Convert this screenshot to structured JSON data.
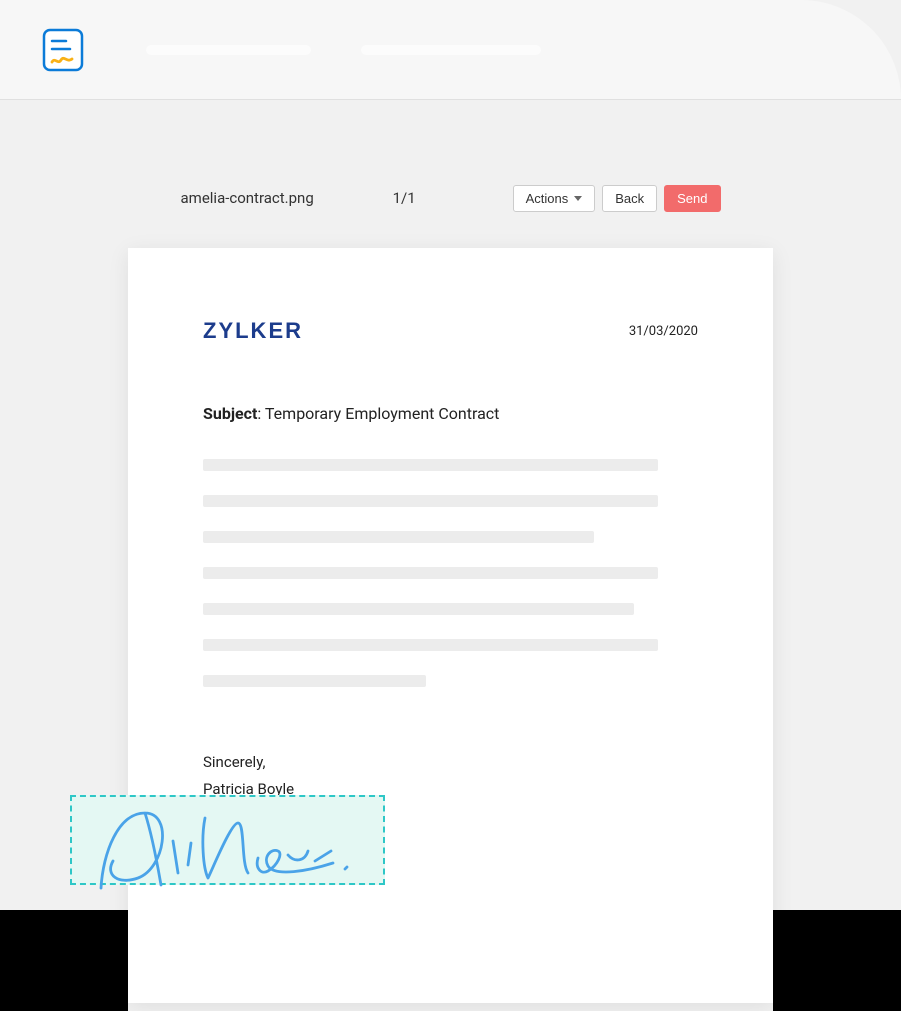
{
  "toolbar": {
    "filename": "amelia-contract.png",
    "page_count": "1/1",
    "actions_label": "Actions",
    "back_label": "Back",
    "send_label": "Send"
  },
  "document": {
    "brand": "ZYLKER",
    "date": "31/03/2020",
    "subject_label": "Subject",
    "subject_value": ": Temporary Employment Contract",
    "closing": "Sincerely,",
    "signer_name": "Patricia Boyle"
  }
}
